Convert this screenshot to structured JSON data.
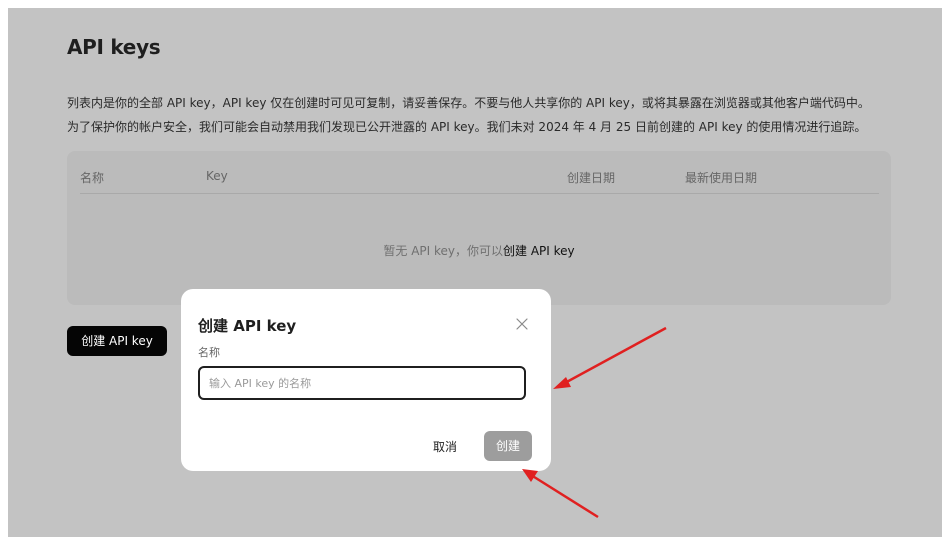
{
  "page": {
    "title": "API keys",
    "description_line1": "列表内是你的全部 API key，API key 仅在创建时可见可复制，请妥善保存。不要与他人共享你的 API key，或将其暴露在浏览器或其他客户端代码中。",
    "description_line2": "为了保护你的帐户安全，我们可能会自动禁用我们发现已公开泄露的 API key。我们未对 2024 年 4 月 25 日前创建的 API key 的使用情况进行追踪。"
  },
  "table": {
    "columns": [
      "名称",
      "Key",
      "创建日期",
      "最新使用日期"
    ],
    "empty_text": "暂无 API key，你可以",
    "empty_link": "创建 API key"
  },
  "create_button_label": "创建 API key",
  "modal": {
    "title": "创建 API key",
    "name_label": "名称",
    "name_value": "",
    "name_placeholder": "输入 API key 的名称",
    "cancel_label": "取消",
    "submit_label": "创建"
  },
  "colors": {
    "overlay_background": "#c3c3c3",
    "primary_button": "#050505",
    "disabled_button": "#9d9d9d",
    "annotation_arrow": "#e02020"
  }
}
